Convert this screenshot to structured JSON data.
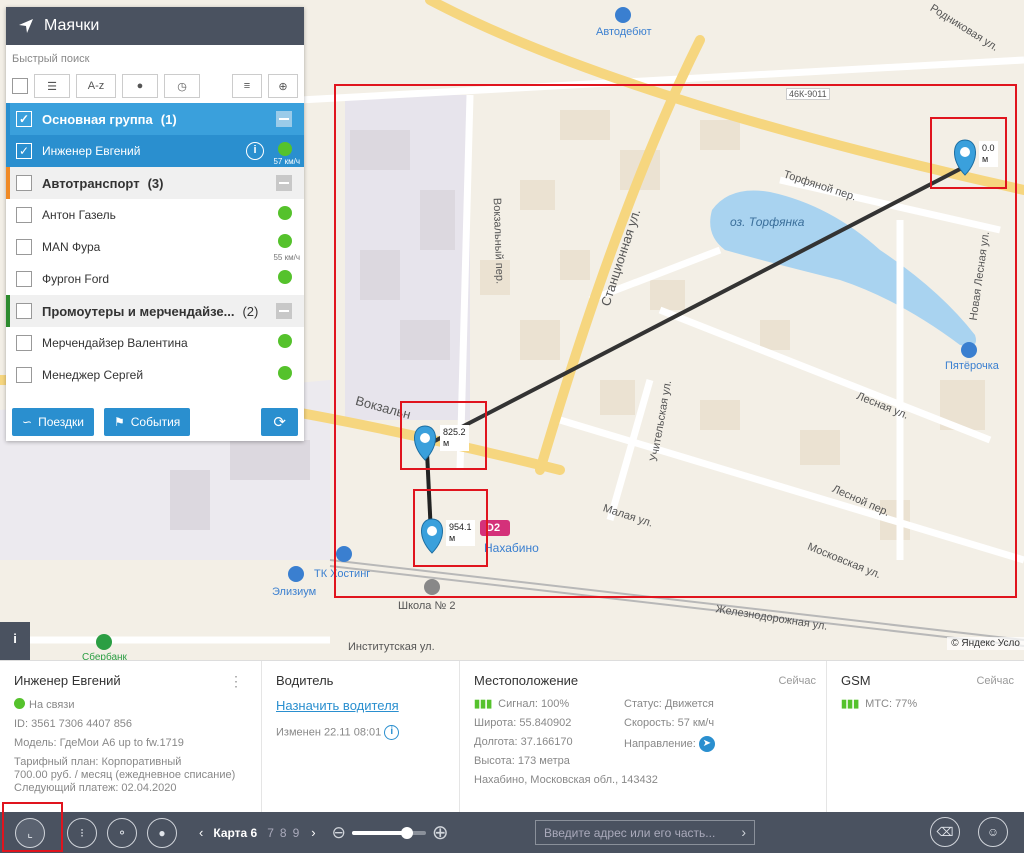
{
  "panel": {
    "title": "Маячки",
    "quick_search": "Быстрый поиск",
    "sort_label": "A-z",
    "groups": [
      {
        "name": "Основная группа",
        "count": "(1)",
        "selected": true
      },
      {
        "name": "Автотранспорт",
        "count": "(3)",
        "selected": false
      },
      {
        "name": "Промоутеры и мерчендайзе...",
        "count": "(2)",
        "selected": false
      }
    ],
    "items": [
      {
        "name": "Инженер Евгений",
        "speed": "57 км/ч"
      },
      {
        "name": "Антон Газель",
        "speed": ""
      },
      {
        "name": "MAN Фура",
        "speed": "55 км/ч"
      },
      {
        "name": "Фургон Ford",
        "speed": ""
      },
      {
        "name": "Мерчендайзер Валентина",
        "speed": ""
      },
      {
        "name": "Менеджер Сергей",
        "speed": ""
      }
    ],
    "trips_button": "Поездки",
    "events_button": "События"
  },
  "map": {
    "streets": {
      "rodnikovaya": "Родниковая ул.",
      "road_sign": "46К-9011",
      "avtodebut": "Автодебют",
      "torfyanoy": "Торфяной пер.",
      "torfyanka": "оз. Торфянка",
      "vokzalny": "Вокзальный пер.",
      "stantsionnaya": "Станционная ул.",
      "novaya_lesnaya": "Новая Лесная ул.",
      "pyaterochka": "Пятёрочка",
      "lesnaya": "Лесная ул.",
      "vokzalnaya": "Вокзальн",
      "uchitelskaya": "Учительская ул.",
      "lesnoy": "Лесной пер.",
      "malaya": "Малая ул.",
      "moskovskaya": "Московская ул.",
      "zheleznodorozhnaya": "Железнодорожная ул.",
      "nakhabino": "Нахабино",
      "d2": "D2",
      "tk": "ТК Хостинг",
      "elizium": "Элизиум",
      "school": "Школа № 2",
      "institutskaya": "Институтская ул.",
      "sberbank": "Сбербанк",
      "yandex": "© Яндекс Усло"
    },
    "markers": [
      {
        "label": "0.0",
        "unit": "м"
      },
      {
        "label": "825.2",
        "unit": "м"
      },
      {
        "label": "954.1",
        "unit": "м"
      }
    ]
  },
  "info": {
    "device": {
      "name": "Инженер Евгений",
      "status": "На связи",
      "id": "ID: 3561 7306 4407 856",
      "model": "Модель: ГдеМои А6 up to fw.1719",
      "plan": "Тарифный план: Корпоративный",
      "price": "700.00 руб. / месяц (ежедневное списание)",
      "next_payment": "Следующий платеж: 02.04.2020"
    },
    "driver": {
      "title": "Водитель",
      "assign": "Назначить водителя",
      "changed": "Изменен 22.11 08:01"
    },
    "location": {
      "title": "Местоположение",
      "now": "Сейчас",
      "signal": "Сигнал: 100%",
      "lat": "Широта: 55.840902",
      "lon": "Долгота: 37.166170",
      "alt": "Высота: 173 метра",
      "address": "Нахабино, Московская обл., 143432",
      "status": "Статус: Движется",
      "speed": "Скорость: 57 км/ч",
      "direction": "Направление:"
    },
    "gsm": {
      "title": "GSM",
      "now": "Сейчас",
      "operator": "МТС: 77%"
    }
  },
  "bottom": {
    "map_name": "Карта 6",
    "pages": [
      "7",
      "8",
      "9"
    ],
    "zoom_level": 0.75,
    "search_placeholder": "Введите адрес или его часть..."
  },
  "colors": {
    "accent": "#2a8fcf",
    "online": "#55c22c",
    "highlight": "#e0141e",
    "toolbar": "#4a5260"
  }
}
